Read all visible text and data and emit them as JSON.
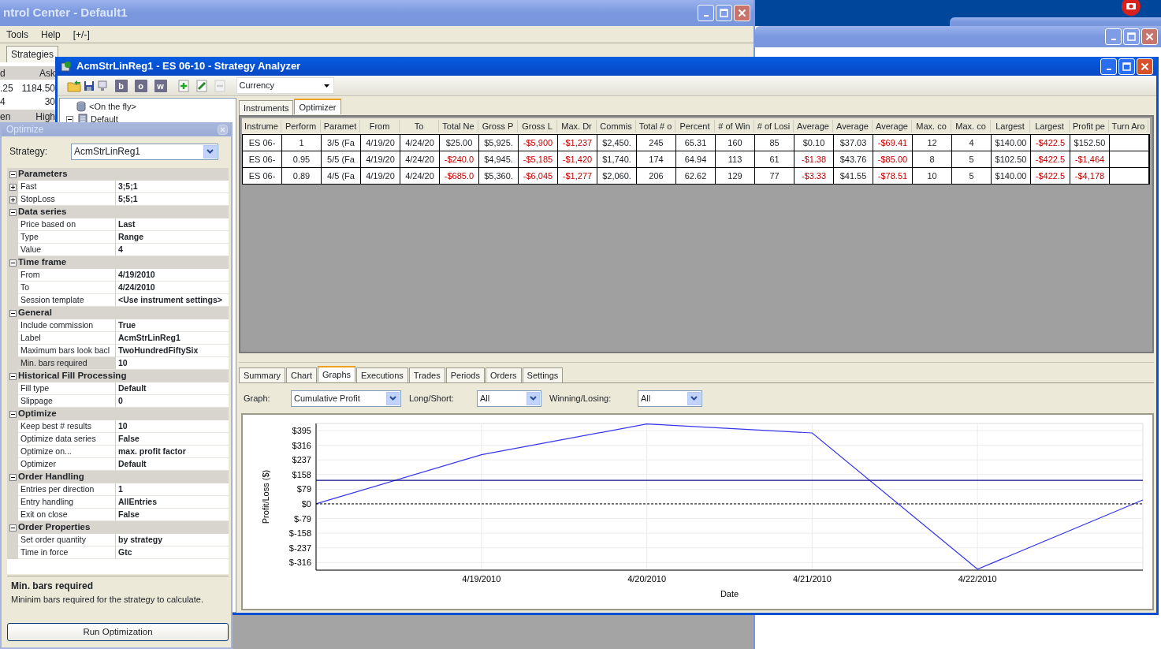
{
  "control_center": {
    "title": "ntrol Center - Default1",
    "menu": [
      "Tools",
      "Help",
      "[+/-]"
    ],
    "tabs": [
      {
        "label": "Strategies",
        "selected": false
      }
    ],
    "grid_rows": [
      {
        "kind": "header",
        "cells": [
          "d",
          "Ask"
        ]
      },
      {
        "kind": "data",
        "cells": [
          ".25",
          "1184.50"
        ]
      },
      {
        "kind": "data",
        "cells": [
          "4",
          "30"
        ]
      },
      {
        "kind": "header",
        "cells": [
          "en",
          "High"
        ]
      }
    ]
  },
  "analyzer": {
    "title": "AcmStrLinReg1  - ES 06-10 - Strategy Analyzer",
    "toolbar": {
      "letter_buttons": [
        "b",
        "o",
        "w"
      ],
      "currency": "Currency"
    },
    "tree": [
      {
        "label": "<On the fly>",
        "kind": "leaf"
      },
      {
        "label": "Default",
        "kind": "group",
        "expanded": true
      }
    ],
    "result_tabs": [
      {
        "label": "Instruments",
        "selected": false
      },
      {
        "label": "Optimizer",
        "selected": true
      }
    ],
    "table": {
      "columns": [
        "Instrume",
        "Perform",
        "Paramet",
        "From",
        "To",
        "Total Ne",
        "Gross P",
        "Gross L",
        "Max. Dr",
        "Commis",
        "Total # o",
        "Percent",
        "# of Win",
        "# of Losi",
        "Average",
        "Average",
        "Average",
        "Max. co",
        "Max. co",
        "Largest",
        "Largest",
        "Profit pe",
        "Turn Aro"
      ],
      "rows": [
        {
          "cells": [
            {
              "text": "ES 06-",
              "loss": false
            },
            {
              "text": "1",
              "loss": false
            },
            {
              "text": "3/5 (Fa",
              "loss": false
            },
            {
              "text": "4/19/20",
              "loss": false
            },
            {
              "text": "4/24/20",
              "loss": false
            },
            {
              "text": "$25.00",
              "loss": false
            },
            {
              "text": "$5,925.",
              "loss": false
            },
            {
              "text": "-$5,900",
              "loss": true
            },
            {
              "text": "-$1,237",
              "loss": true
            },
            {
              "text": "$2,450.",
              "loss": false
            },
            {
              "text": "245",
              "loss": false
            },
            {
              "text": "65.31",
              "loss": false
            },
            {
              "text": "160",
              "loss": false
            },
            {
              "text": "85",
              "loss": false
            },
            {
              "text": "$0.10",
              "loss": false
            },
            {
              "text": "$37.03",
              "loss": false
            },
            {
              "text": "-$69.41",
              "loss": true
            },
            {
              "text": "12",
              "loss": false
            },
            {
              "text": "4",
              "loss": false
            },
            {
              "text": "$140.00",
              "loss": false
            },
            {
              "text": "-$422.5",
              "loss": true
            },
            {
              "text": "$152.50",
              "loss": false
            }
          ]
        },
        {
          "cells": [
            {
              "text": "ES 06-",
              "loss": false
            },
            {
              "text": "0.95",
              "loss": false
            },
            {
              "text": "5/5 (Fa",
              "loss": false
            },
            {
              "text": "4/19/20",
              "loss": false
            },
            {
              "text": "4/24/20",
              "loss": false
            },
            {
              "text": "-$240.0",
              "loss": true
            },
            {
              "text": "$4,945.",
              "loss": false
            },
            {
              "text": "-$5,185",
              "loss": true
            },
            {
              "text": "-$1,420",
              "loss": true
            },
            {
              "text": "$1,740.",
              "loss": false
            },
            {
              "text": "174",
              "loss": false
            },
            {
              "text": "64.94",
              "loss": false
            },
            {
              "text": "113",
              "loss": false
            },
            {
              "text": "61",
              "loss": false
            },
            {
              "text": "-$1.38",
              "loss": true
            },
            {
              "text": "$43.76",
              "loss": false
            },
            {
              "text": "-$85.00",
              "loss": true
            },
            {
              "text": "8",
              "loss": false
            },
            {
              "text": "5",
              "loss": false
            },
            {
              "text": "$102.50",
              "loss": false
            },
            {
              "text": "-$422.5",
              "loss": true
            },
            {
              "text": "-$1,464",
              "loss": true
            }
          ]
        },
        {
          "cells": [
            {
              "text": "ES 06-",
              "loss": false
            },
            {
              "text": "0.89",
              "loss": false
            },
            {
              "text": "4/5 (Fa",
              "loss": false
            },
            {
              "text": "4/19/20",
              "loss": false
            },
            {
              "text": "4/24/20",
              "loss": false
            },
            {
              "text": "-$685.0",
              "loss": true
            },
            {
              "text": "$5,360.",
              "loss": false
            },
            {
              "text": "-$6,045",
              "loss": true
            },
            {
              "text": "-$1,277",
              "loss": true
            },
            {
              "text": "$2,060.",
              "loss": false
            },
            {
              "text": "206",
              "loss": false
            },
            {
              "text": "62.62",
              "loss": false
            },
            {
              "text": "129",
              "loss": false
            },
            {
              "text": "77",
              "loss": false
            },
            {
              "text": "-$3.33",
              "loss": true
            },
            {
              "text": "$41.55",
              "loss": false
            },
            {
              "text": "-$78.51",
              "loss": true
            },
            {
              "text": "10",
              "loss": false
            },
            {
              "text": "5",
              "loss": false
            },
            {
              "text": "$140.00",
              "loss": false
            },
            {
              "text": "-$422.5",
              "loss": true
            },
            {
              "text": "-$4,178",
              "loss": true
            }
          ]
        }
      ]
    },
    "detail_tabs": [
      {
        "label": "Summary",
        "selected": false
      },
      {
        "label": "Chart",
        "selected": false
      },
      {
        "label": "Graphs",
        "selected": true
      },
      {
        "label": "Executions",
        "selected": false
      },
      {
        "label": "Trades",
        "selected": false
      },
      {
        "label": "Periods",
        "selected": false
      },
      {
        "label": "Orders",
        "selected": false
      },
      {
        "label": "Settings",
        "selected": false
      }
    ],
    "filters": [
      {
        "label": "Graph:",
        "value": "Cumulative Profit"
      },
      {
        "label": "Long/Short:",
        "value": "All"
      },
      {
        "label": "Winning/Losing:",
        "value": "All"
      }
    ],
    "chart_data": {
      "type": "line",
      "xlabel": "Date",
      "ylabel": "Profit/Loss ($)",
      "categories": [
        null,
        "4/19/2010",
        "4/20/2010",
        "4/21/2010",
        "4/22/2010",
        null
      ],
      "ylim": [
        -357,
        433
      ],
      "yticks": [
        {
          "value": 395,
          "label": "$395"
        },
        {
          "value": 316,
          "label": "$316"
        },
        {
          "value": 237,
          "label": "$237"
        },
        {
          "value": 158,
          "label": "$158"
        },
        {
          "value": 79,
          "label": "$79"
        },
        {
          "value": 0,
          "label": "$0"
        },
        {
          "value": -79,
          "label": "$-79"
        },
        {
          "value": -158,
          "label": "$-158"
        },
        {
          "value": -237,
          "label": "$-237"
        },
        {
          "value": -316,
          "label": "$-316"
        }
      ],
      "series": [
        {
          "color": "#3535f0",
          "values": [
            0,
            265,
            430,
            382,
            -352,
            21
          ]
        },
        {
          "color": "#10108a",
          "values": [
            127,
            127,
            127,
            127,
            127,
            127
          ]
        },
        {
          "color": "#000000",
          "line_style": "dashed",
          "values": [
            0,
            0,
            0,
            0,
            0,
            0
          ]
        }
      ],
      "grid": true
    }
  },
  "optimize": {
    "title": "Optimize",
    "strategy_label": "Strategy:",
    "strategy": "AcmStrLinReg1",
    "categories": [
      {
        "name": "Parameters",
        "expanded": true,
        "rows": [
          {
            "name": "Fast",
            "value": "3;5;1",
            "expandable": true,
            "selected": false
          },
          {
            "name": "StopLoss",
            "value": "5;5;1",
            "expandable": true,
            "selected": false
          }
        ]
      },
      {
        "name": "Data series",
        "expanded": true,
        "rows": [
          {
            "name": "Price based on",
            "value": "Last",
            "expandable": false,
            "selected": false
          },
          {
            "name": "Type",
            "value": "Range",
            "expandable": false,
            "selected": false
          },
          {
            "name": "Value",
            "value": "4",
            "expandable": false,
            "selected": false
          }
        ]
      },
      {
        "name": "Time frame",
        "expanded": true,
        "rows": [
          {
            "name": "From",
            "value": "4/19/2010",
            "expandable": false,
            "selected": false
          },
          {
            "name": "To",
            "value": "4/24/2010",
            "expandable": false,
            "selected": false
          },
          {
            "name": "Session template",
            "value": "<Use instrument settings>",
            "expandable": false,
            "selected": false
          }
        ]
      },
      {
        "name": "General",
        "expanded": true,
        "rows": [
          {
            "name": "Include commission",
            "value": "True",
            "expandable": false,
            "selected": false
          },
          {
            "name": "Label",
            "value": "AcmStrLinReg1",
            "expandable": false,
            "selected": false
          },
          {
            "name": "Maximum bars look bacl",
            "value": "TwoHundredFiftySix",
            "expandable": false,
            "selected": false
          },
          {
            "name": "Min. bars required",
            "value": "10",
            "expandable": false,
            "selected": true
          }
        ]
      },
      {
        "name": "Historical Fill Processing",
        "expanded": true,
        "rows": [
          {
            "name": "Fill type",
            "value": "Default",
            "expandable": false,
            "selected": false
          },
          {
            "name": "Slippage",
            "value": "0",
            "expandable": false,
            "selected": false
          }
        ]
      },
      {
        "name": "Optimize",
        "expanded": true,
        "rows": [
          {
            "name": "Keep best # results",
            "value": "10",
            "expandable": false,
            "selected": false
          },
          {
            "name": "Optimize data series",
            "value": "False",
            "expandable": false,
            "selected": false
          },
          {
            "name": "Optimize on...",
            "value": "max. profit factor",
            "expandable": false,
            "selected": false
          },
          {
            "name": "Optimizer",
            "value": "Default",
            "expandable": false,
            "selected": false
          }
        ]
      },
      {
        "name": "Order Handling",
        "expanded": true,
        "rows": [
          {
            "name": "Entries per direction",
            "value": "1",
            "expandable": false,
            "selected": false
          },
          {
            "name": "Entry handling",
            "value": "AllEntries",
            "expandable": false,
            "selected": false
          },
          {
            "name": "Exit on close",
            "value": "False",
            "expandable": false,
            "selected": false
          }
        ]
      },
      {
        "name": "Order Properties",
        "expanded": true,
        "rows": [
          {
            "name": "Set order quantity",
            "value": "by strategy",
            "expandable": false,
            "selected": false
          },
          {
            "name": "Time in force",
            "value": "Gtc",
            "expandable": false,
            "selected": false
          }
        ]
      }
    ],
    "description": {
      "title": "Min. bars required",
      "text": "Mininim bars required for the strategy to calculate."
    },
    "button": "Run Optimization"
  }
}
